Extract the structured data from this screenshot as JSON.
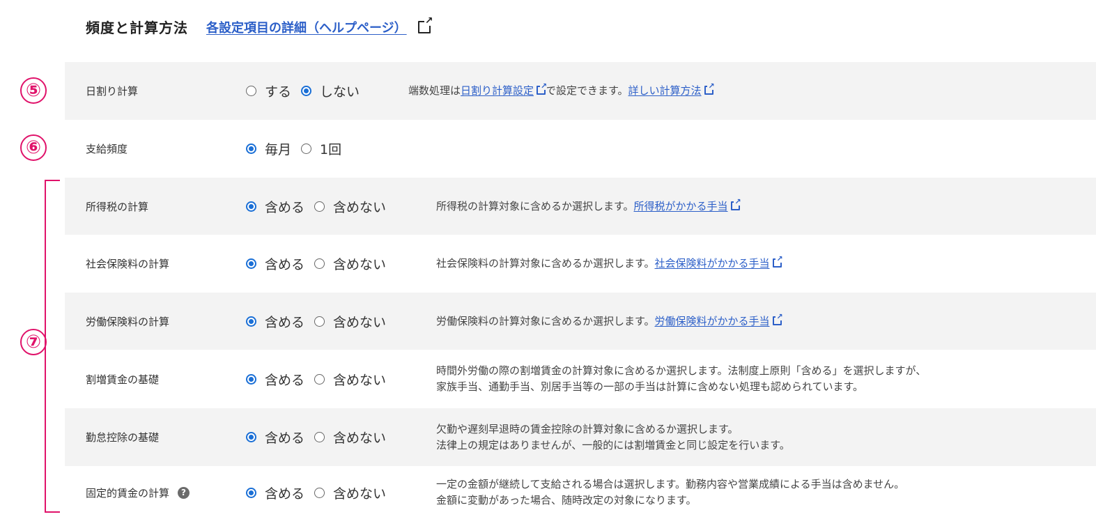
{
  "header": {
    "title": "頻度と計算方法",
    "help_link": "各設定項目の詳細（ヘルプページ）"
  },
  "annotations": [
    "⑤",
    "⑥",
    "⑦"
  ],
  "rows": [
    {
      "label": "日割り計算",
      "options": [
        {
          "label": "する",
          "selected": false
        },
        {
          "label": "しない",
          "selected": true
        }
      ],
      "desc_prefix": "端数処理は",
      "link1": "日割り計算設定",
      "desc_middle": "で設定できます。",
      "link2": "詳しい計算方法"
    },
    {
      "label": "支給頻度",
      "options": [
        {
          "label": "毎月",
          "selected": true
        },
        {
          "label": "1回",
          "selected": false
        }
      ]
    },
    {
      "label": "所得税の計算",
      "options": [
        {
          "label": "含める",
          "selected": true
        },
        {
          "label": "含めない",
          "selected": false
        }
      ],
      "desc": "所得税の計算対象に含めるか選択します。",
      "link": "所得税がかかる手当"
    },
    {
      "label": "社会保険料の計算",
      "options": [
        {
          "label": "含める",
          "selected": true
        },
        {
          "label": "含めない",
          "selected": false
        }
      ],
      "desc": "社会保険料の計算対象に含めるか選択します。",
      "link": "社会保険料がかかる手当"
    },
    {
      "label": "労働保険料の計算",
      "options": [
        {
          "label": "含める",
          "selected": true
        },
        {
          "label": "含めない",
          "selected": false
        }
      ],
      "desc": "労働保険料の計算対象に含めるか選択します。",
      "link": "労働保険料がかかる手当"
    },
    {
      "label": "割増賃金の基礎",
      "options": [
        {
          "label": "含める",
          "selected": true
        },
        {
          "label": "含めない",
          "selected": false
        }
      ],
      "desc_line1": "時間外労働の際の割増賃金の計算対象に含めるか選択します。法制度上原則「含める」を選択しますが、",
      "desc_line2": "家族手当、通勤手当、別居手当等の一部の手当は計算に含めない処理も認められています。"
    },
    {
      "label": "勤怠控除の基礎",
      "options": [
        {
          "label": "含める",
          "selected": true
        },
        {
          "label": "含めない",
          "selected": false
        }
      ],
      "desc_line1": "欠勤や遅刻早退時の賃金控除の計算対象に含めるか選択します。",
      "desc_line2": "法律上の規定はありませんが、一般的には割増賃金と同じ設定を行います。"
    },
    {
      "label": "固定的賃金の計算",
      "help_icon": "?",
      "options": [
        {
          "label": "含める",
          "selected": true
        },
        {
          "label": "含めない",
          "selected": false
        }
      ],
      "desc_line1": "一定の金額が継続して支給される場合は選択します。勤務内容や営業成績による手当は含めません。",
      "desc_line2": "金額に変動があった場合、随時改定の対象になります。"
    }
  ],
  "colors": {
    "accent": "#1a6fd6",
    "link": "#2c5fc8",
    "annotation": "#e0126a",
    "row_alt": "#f3f3f3"
  }
}
